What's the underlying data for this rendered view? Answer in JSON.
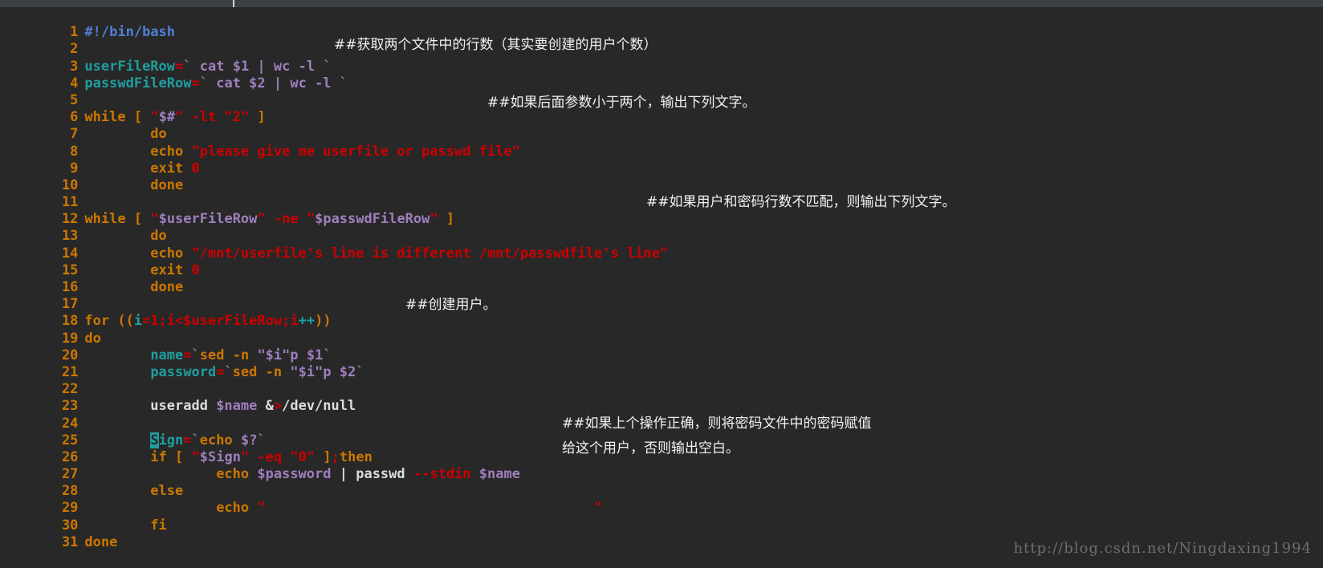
{
  "window": {
    "theme_background": "#282828",
    "titlebar_background": "#3c4043",
    "accent_cursor_color": "#1f9ea0"
  },
  "editor": {
    "language": "bash",
    "total_lines": 31,
    "cursor_line": 25,
    "cursor_char": "S",
    "line_numbers": [
      "1",
      "2",
      "3",
      "4",
      "5",
      "6",
      "7",
      "8",
      "9",
      "10",
      "11",
      "12",
      "13",
      "14",
      "15",
      "16",
      "17",
      "18",
      "19",
      "20",
      "21",
      "22",
      "23",
      "24",
      "25",
      "26",
      "27",
      "28",
      "29",
      "30",
      "31"
    ],
    "lines": [
      "#!/bin/bash",
      "",
      "userFileRow=` cat $1 | wc -l `",
      "passwdFileRow=` cat $2 | wc -l `",
      "",
      "while [ \"$#\" -lt \"2\" ]",
      "        do",
      "        echo \"please give me userfile or passwd file\"",
      "        exit 0",
      "        done",
      "",
      "while [ \"$userFileRow\" -ne \"$passwdFileRow\" ]",
      "        do",
      "        echo \"/mnt/userfile's line is different /mnt/passwdfile's line\"",
      "        exit 0",
      "        done",
      "",
      "for ((i=1;i<$userFileRow;i++))",
      "do",
      "        name=`sed -n \"$i\"p $1`",
      "        password=`sed -n \"$i\"p $2`",
      "",
      "        useradd $name &>/dev/null",
      "",
      "        Sign=`echo $?`",
      "        if [ \"$Sign\" -eq \"0\" ];then",
      "                echo $password | passwd --stdin $name",
      "        else",
      "                echo \"                                        \"",
      "        fi",
      "done"
    ]
  },
  "annotations": [
    {
      "id": "note-1",
      "text": "##获取两个文件中的行数（其实要创建的用户个数）",
      "for_line": 3
    },
    {
      "id": "note-2",
      "text": "##如果后面参数小于两个，输出下列文字。",
      "for_line": 6
    },
    {
      "id": "note-3",
      "text": "##如果用户和密码行数不匹配，则输出下列文字。",
      "for_line": 12
    },
    {
      "id": "note-4",
      "text": "##创建用户。",
      "for_line": 20
    },
    {
      "id": "note-5-line1",
      "text": "##如果上个操作正确，则将密码文件中的密码赋值",
      "for_line": 25
    },
    {
      "id": "note-5-line2",
      "text": "给这个用户，否则输出空白。",
      "for_line": 26
    }
  ],
  "watermark": {
    "text": "http://blog.csdn.net/Ningdaxing1994"
  }
}
